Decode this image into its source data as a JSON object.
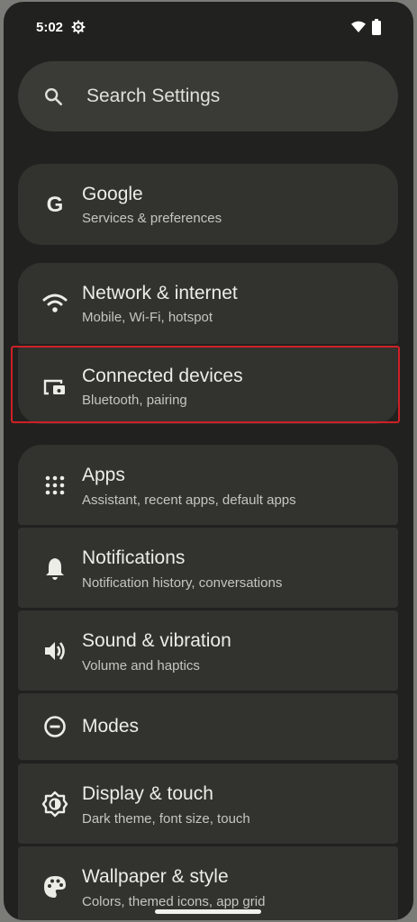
{
  "status_bar": {
    "time": "5:02"
  },
  "search": {
    "placeholder": "Search Settings"
  },
  "items": [
    {
      "title": "Google",
      "subtitle": "Services & preferences",
      "icon": "google-icon"
    },
    {
      "title": "Network & internet",
      "subtitle": "Mobile, Wi-Fi, hotspot",
      "icon": "wifi-icon"
    },
    {
      "title": "Connected devices",
      "subtitle": "Bluetooth, pairing",
      "icon": "connected-devices-icon"
    },
    {
      "title": "Apps",
      "subtitle": "Assistant, recent apps, default apps",
      "icon": "apps-grid-icon"
    },
    {
      "title": "Notifications",
      "subtitle": "Notification history, conversations",
      "icon": "bell-icon"
    },
    {
      "title": "Sound & vibration",
      "subtitle": "Volume and haptics",
      "icon": "volume-icon"
    },
    {
      "title": "Modes",
      "subtitle": "",
      "icon": "modes-icon"
    },
    {
      "title": "Display & touch",
      "subtitle": "Dark theme, font size, touch",
      "icon": "brightness-icon"
    },
    {
      "title": "Wallpaper & style",
      "subtitle": "Colors, themed icons, app grid",
      "icon": "palette-icon"
    }
  ],
  "highlight_color": "#cf2026"
}
